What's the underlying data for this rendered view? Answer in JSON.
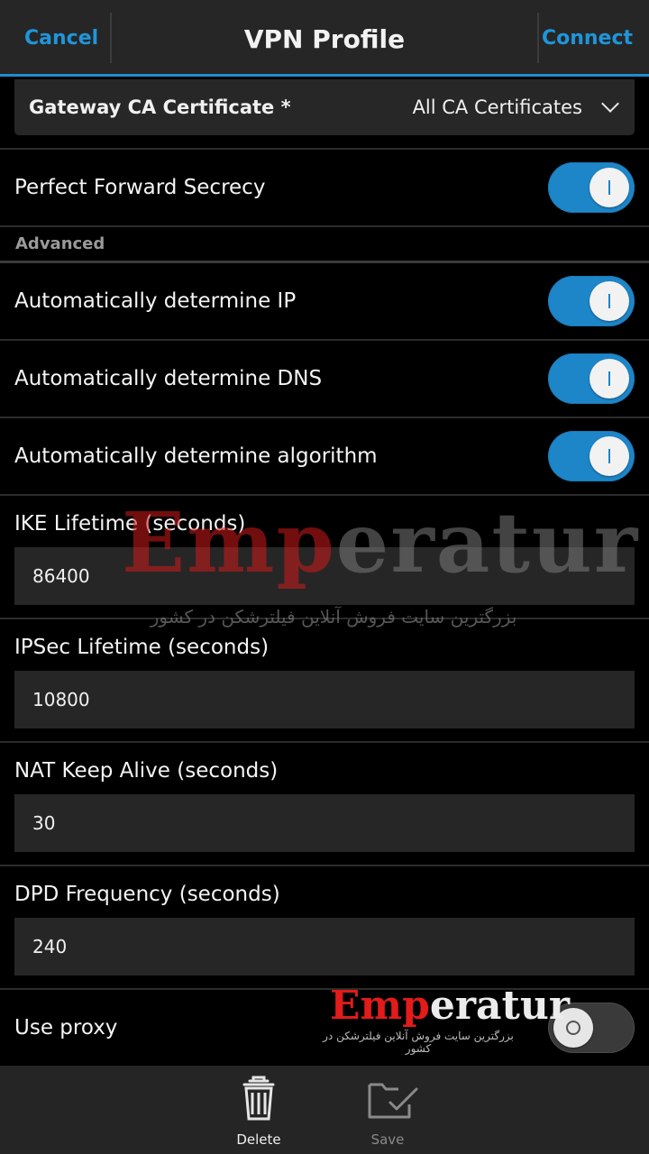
{
  "titlebar": {
    "cancel_label": "Cancel",
    "title": "VPN Profile",
    "connect_label": "Connect"
  },
  "gateway": {
    "label": "Gateway CA Certificate *",
    "value": "All CA Certificates"
  },
  "pfs": {
    "label": "Perfect Forward Secrecy",
    "enabled": true
  },
  "advanced": {
    "header": "Advanced",
    "auto_ip": {
      "label": "Automatically determine IP",
      "enabled": true
    },
    "auto_dns": {
      "label": "Automatically determine DNS",
      "enabled": true
    },
    "auto_algorithm": {
      "label": "Automatically determine algorithm",
      "enabled": true
    }
  },
  "fields": {
    "ike_lifetime": {
      "label": "IKE Lifetime (seconds)",
      "value": "86400"
    },
    "ipsec_lifetime": {
      "label": "IPSec Lifetime (seconds)",
      "value": "10800"
    },
    "nat_keep_alive": {
      "label": "NAT Keep Alive (seconds)",
      "value": "30"
    },
    "dpd_frequency": {
      "label": "DPD Frequency (seconds)",
      "value": "240"
    }
  },
  "proxy": {
    "label": "Use proxy",
    "enabled": false
  },
  "watermark": {
    "brand_part1": "Emp",
    "brand_part2": "eratur",
    "tagline": "بزرگترین سایت فروش آنلاین فیلترشکن در کشور"
  },
  "actionbar": {
    "delete_label": "Delete",
    "save_label": "Save"
  },
  "colors": {
    "accent": "#1f8dd0",
    "toggle_on": "#1d86c9",
    "background": "#000000",
    "bar": "#262626"
  }
}
